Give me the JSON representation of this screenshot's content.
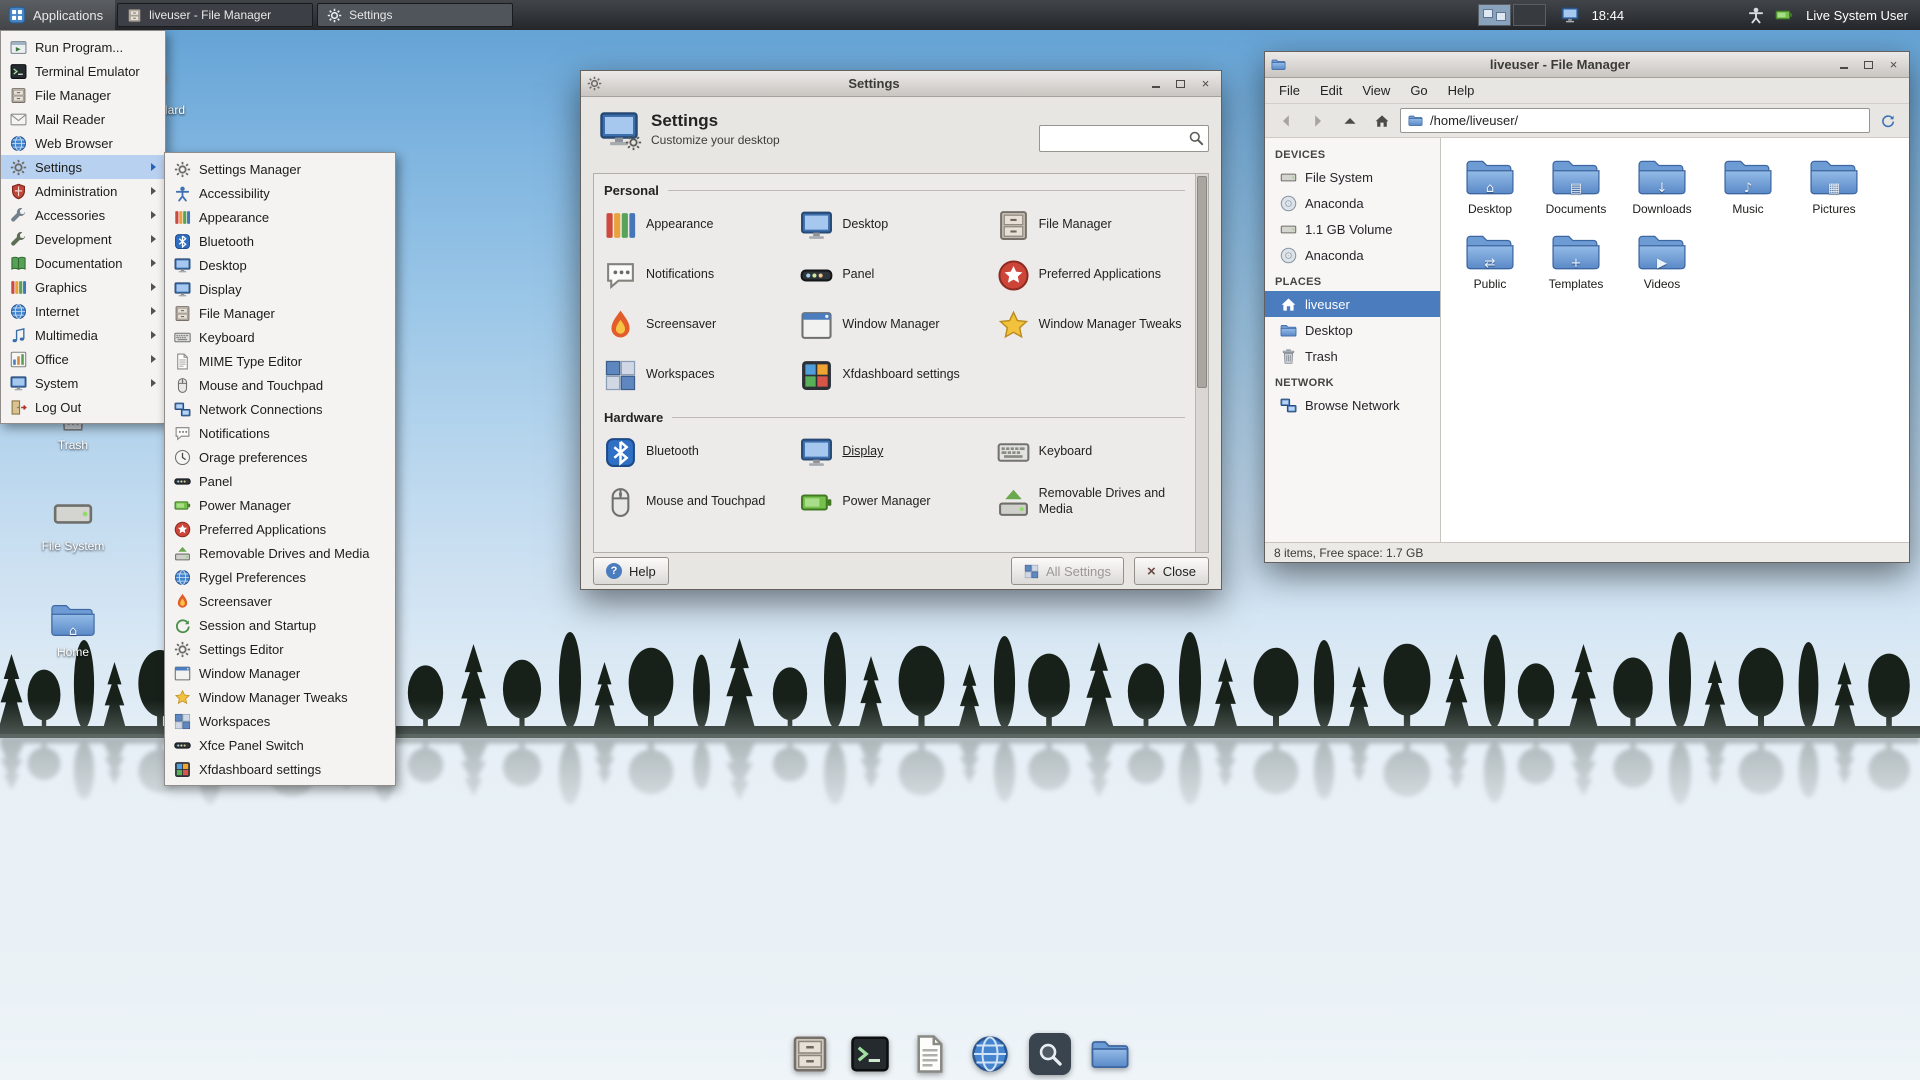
{
  "panel": {
    "applications_label": "Applications",
    "tasks": [
      {
        "icon": "file-cabinet",
        "label": "liveuser - File Manager"
      },
      {
        "icon": "settings",
        "label": "Settings"
      }
    ],
    "workspaces": {
      "count": 2,
      "active": 1
    },
    "clock": "18:44",
    "user": "Live System User"
  },
  "applications_menu": {
    "items": [
      {
        "label": "Run Program...",
        "icon": "run-dialog"
      },
      {
        "label": "Terminal Emulator",
        "icon": "terminal"
      },
      {
        "label": "File Manager",
        "icon": "file-cabinet"
      },
      {
        "label": "Mail Reader",
        "icon": "mail"
      },
      {
        "label": "Web Browser",
        "icon": "web-browser"
      },
      {
        "label": "Settings",
        "icon": "settings",
        "has_submenu": true,
        "highlighted": true
      },
      {
        "label": "Administration",
        "icon": "administration",
        "has_submenu": true
      },
      {
        "label": "Accessories",
        "icon": "accessories",
        "has_submenu": true
      },
      {
        "label": "Development",
        "icon": "development",
        "has_submenu": true
      },
      {
        "label": "Documentation",
        "icon": "documentation",
        "has_submenu": true
      },
      {
        "label": "Graphics",
        "icon": "graphics",
        "has_submenu": true
      },
      {
        "label": "Internet",
        "icon": "internet",
        "has_submenu": true
      },
      {
        "label": "Multimedia",
        "icon": "multimedia",
        "has_submenu": true
      },
      {
        "label": "Office",
        "icon": "office",
        "has_submenu": true
      },
      {
        "label": "System",
        "icon": "system",
        "has_submenu": true
      },
      {
        "label": "Log Out",
        "icon": "log-out"
      }
    ]
  },
  "settings_menu": {
    "items": [
      {
        "label": "Settings Manager",
        "icon": "settings-manager"
      },
      {
        "label": "Accessibility",
        "icon": "accessibility"
      },
      {
        "label": "Appearance",
        "icon": "appearance"
      },
      {
        "label": "Bluetooth",
        "icon": "bluetooth"
      },
      {
        "label": "Desktop",
        "icon": "desktop"
      },
      {
        "label": "Display",
        "icon": "display"
      },
      {
        "label": "File Manager",
        "icon": "file-cabinet"
      },
      {
        "label": "Keyboard",
        "icon": "keyboard"
      },
      {
        "label": "MIME Type Editor",
        "icon": "mime-editor"
      },
      {
        "label": "Mouse and Touchpad",
        "icon": "mouse"
      },
      {
        "label": "Network Connections",
        "icon": "network"
      },
      {
        "label": "Notifications",
        "icon": "notifications"
      },
      {
        "label": "Orage preferences",
        "icon": "calendar-clock"
      },
      {
        "label": "Panel",
        "icon": "panel"
      },
      {
        "label": "Power Manager",
        "icon": "power"
      },
      {
        "label": "Preferred Applications",
        "icon": "preferred-applications"
      },
      {
        "label": "Removable Drives and Media",
        "icon": "removable-media"
      },
      {
        "label": "Rygel Preferences",
        "icon": "media-share"
      },
      {
        "label": "Screensaver",
        "icon": "screensaver"
      },
      {
        "label": "Session and Startup",
        "icon": "session"
      },
      {
        "label": "Settings Editor",
        "icon": "settings-editor"
      },
      {
        "label": "Window Manager",
        "icon": "window-manager"
      },
      {
        "label": "Window Manager Tweaks",
        "icon": "wm-tweaks"
      },
      {
        "label": "Workspaces",
        "icon": "workspaces"
      },
      {
        "label": "Xfce Panel Switch",
        "icon": "panel-switch"
      },
      {
        "label": "Xfdashboard settings",
        "icon": "xfdashboard"
      }
    ]
  },
  "desktop": {
    "icons": [
      {
        "label": "Install to Hard Drive",
        "icon": "installer-disc"
      },
      {
        "label": "Trash",
        "icon": "trash"
      },
      {
        "label": "File System",
        "icon": "hard-drive"
      },
      {
        "label": "Home",
        "icon": "home-folder"
      }
    ]
  },
  "settings_window": {
    "title": "Settings",
    "heading": "Settings",
    "subheading": "Customize your desktop",
    "search_value": "",
    "sections": [
      {
        "name": "Personal",
        "items": [
          {
            "label": "Appearance",
            "icon": "appearance"
          },
          {
            "label": "Desktop",
            "icon": "desktop"
          },
          {
            "label": "File Manager",
            "icon": "file-cabinet"
          },
          {
            "label": "Notifications",
            "icon": "notifications"
          },
          {
            "label": "Panel",
            "icon": "panel"
          },
          {
            "label": "Preferred Applications",
            "icon": "preferred-applications"
          },
          {
            "label": "Screensaver",
            "icon": "screensaver"
          },
          {
            "label": "Window Manager",
            "icon": "window-manager"
          },
          {
            "label": "Window Manager Tweaks",
            "icon": "wm-tweaks"
          },
          {
            "label": "Workspaces",
            "icon": "workspaces"
          },
          {
            "label": "Xfdashboard settings",
            "icon": "xfdashboard"
          }
        ]
      },
      {
        "name": "Hardware",
        "items": [
          {
            "label": "Bluetooth",
            "icon": "bluetooth"
          },
          {
            "label": "Display",
            "icon": "display",
            "underlined": true
          },
          {
            "label": "Keyboard",
            "icon": "keyboard"
          },
          {
            "label": "Mouse and Touchpad",
            "icon": "mouse"
          },
          {
            "label": "Power Manager",
            "icon": "power"
          },
          {
            "label": "Removable Drives and Media",
            "icon": "removable-media"
          }
        ]
      }
    ],
    "help_label": "Help",
    "all_settings_label": "All Settings",
    "close_label": "Close"
  },
  "file_manager": {
    "title": "liveuser - File Manager",
    "menu": [
      "File",
      "Edit",
      "View",
      "Go",
      "Help"
    ],
    "path": "/home/liveuser/",
    "sidebar": {
      "devices_header": "DEVICES",
      "devices": [
        {
          "label": "File System",
          "icon": "hard-drive"
        },
        {
          "label": "Anaconda",
          "icon": "optical-disc"
        },
        {
          "label": "1.1 GB Volume",
          "icon": "hard-drive"
        },
        {
          "label": "Anaconda",
          "icon": "optical-disc"
        }
      ],
      "places_header": "PLACES",
      "places": [
        {
          "label": "liveuser",
          "icon": "home",
          "selected": true
        },
        {
          "label": "Desktop",
          "icon": "folder"
        },
        {
          "label": "Trash",
          "icon": "trash"
        }
      ],
      "network_header": "NETWORK",
      "network": [
        {
          "label": "Browse Network",
          "icon": "network"
        }
      ]
    },
    "files": [
      {
        "label": "Desktop",
        "icon": "folder-desktop"
      },
      {
        "label": "Documents",
        "icon": "folder-documents"
      },
      {
        "label": "Downloads",
        "icon": "folder-downloads"
      },
      {
        "label": "Music",
        "icon": "folder-music"
      },
      {
        "label": "Pictures",
        "icon": "folder-pictures"
      },
      {
        "label": "Public",
        "icon": "folder-public"
      },
      {
        "label": "Templates",
        "icon": "folder-templates"
      },
      {
        "label": "Videos",
        "icon": "folder-videos"
      }
    ],
    "status": "8 items, Free space: 1.7 GB"
  },
  "dock": {
    "items": [
      {
        "icon": "file-cabinet"
      },
      {
        "icon": "terminal"
      },
      {
        "icon": "text-editor"
      },
      {
        "icon": "web-browser"
      },
      {
        "icon": "application-finder"
      },
      {
        "icon": "file-manager"
      }
    ]
  }
}
